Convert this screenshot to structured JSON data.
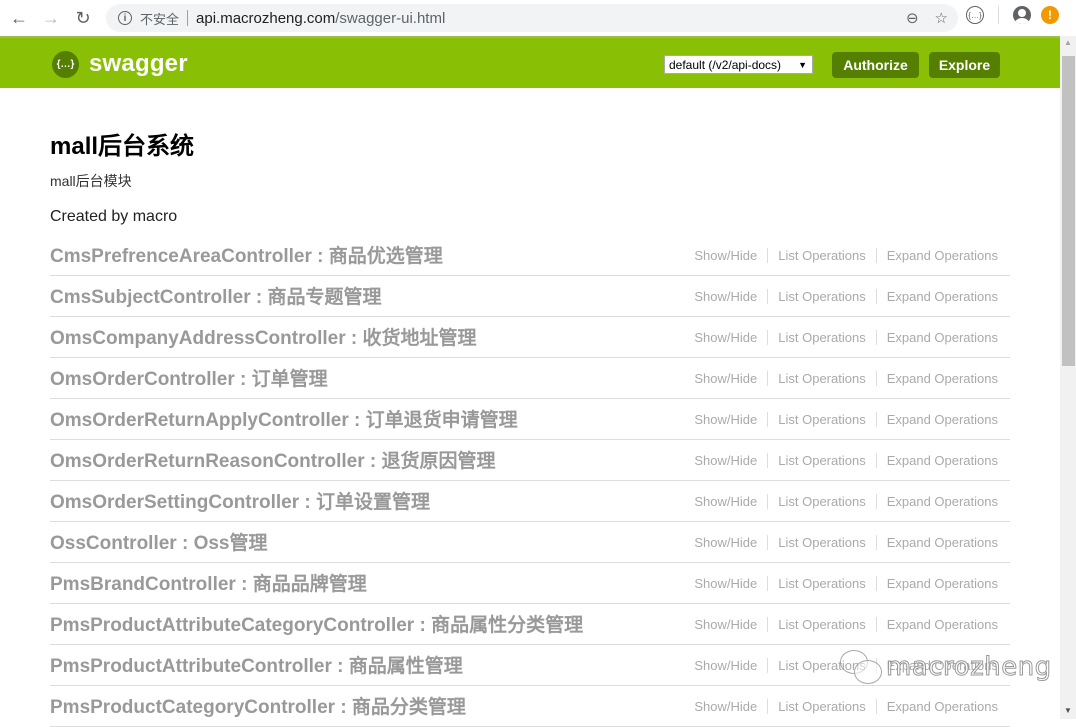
{
  "browser": {
    "back_icon": "←",
    "forward_icon": "→",
    "reload_icon": "↻",
    "security_label": "不安全",
    "url_host": "api.macrozheng.com",
    "url_path": "/swagger-ui.html",
    "zoom_icon": "⊖",
    "bookmark_icon": "☆",
    "extension_icon": "{…}",
    "alert_icon": "!"
  },
  "header": {
    "logo_mark": "{…}",
    "logo_text": "swagger",
    "spec_selector": "default (/v2/api-docs)",
    "authorize_label": "Authorize",
    "explore_label": "Explore",
    "brand_color": "#89bf04",
    "button_color": "#547f00"
  },
  "info": {
    "title": "mall后台系统",
    "description": "mall后台模块",
    "created_by": "Created by macro"
  },
  "operations_labels": {
    "show_hide": "Show/Hide",
    "list": "List Operations",
    "expand": "Expand Operations"
  },
  "resources": [
    {
      "name": "CmsPrefrenceAreaController : 商品优选管理"
    },
    {
      "name": "CmsSubjectController : 商品专题管理"
    },
    {
      "name": "OmsCompanyAddressController : 收货地址管理"
    },
    {
      "name": "OmsOrderController : 订单管理"
    },
    {
      "name": "OmsOrderReturnApplyController : 订单退货申请管理"
    },
    {
      "name": "OmsOrderReturnReasonController : 退货原因管理"
    },
    {
      "name": "OmsOrderSettingController : 订单设置管理"
    },
    {
      "name": "OssController : Oss管理"
    },
    {
      "name": "PmsBrandController : 商品品牌管理"
    },
    {
      "name": "PmsProductAttributeCategoryController : 商品属性分类管理"
    },
    {
      "name": "PmsProductAttributeController : 商品属性管理"
    },
    {
      "name": "PmsProductCategoryController : 商品分类管理"
    }
  ],
  "watermark": {
    "text": "macrozheng"
  }
}
